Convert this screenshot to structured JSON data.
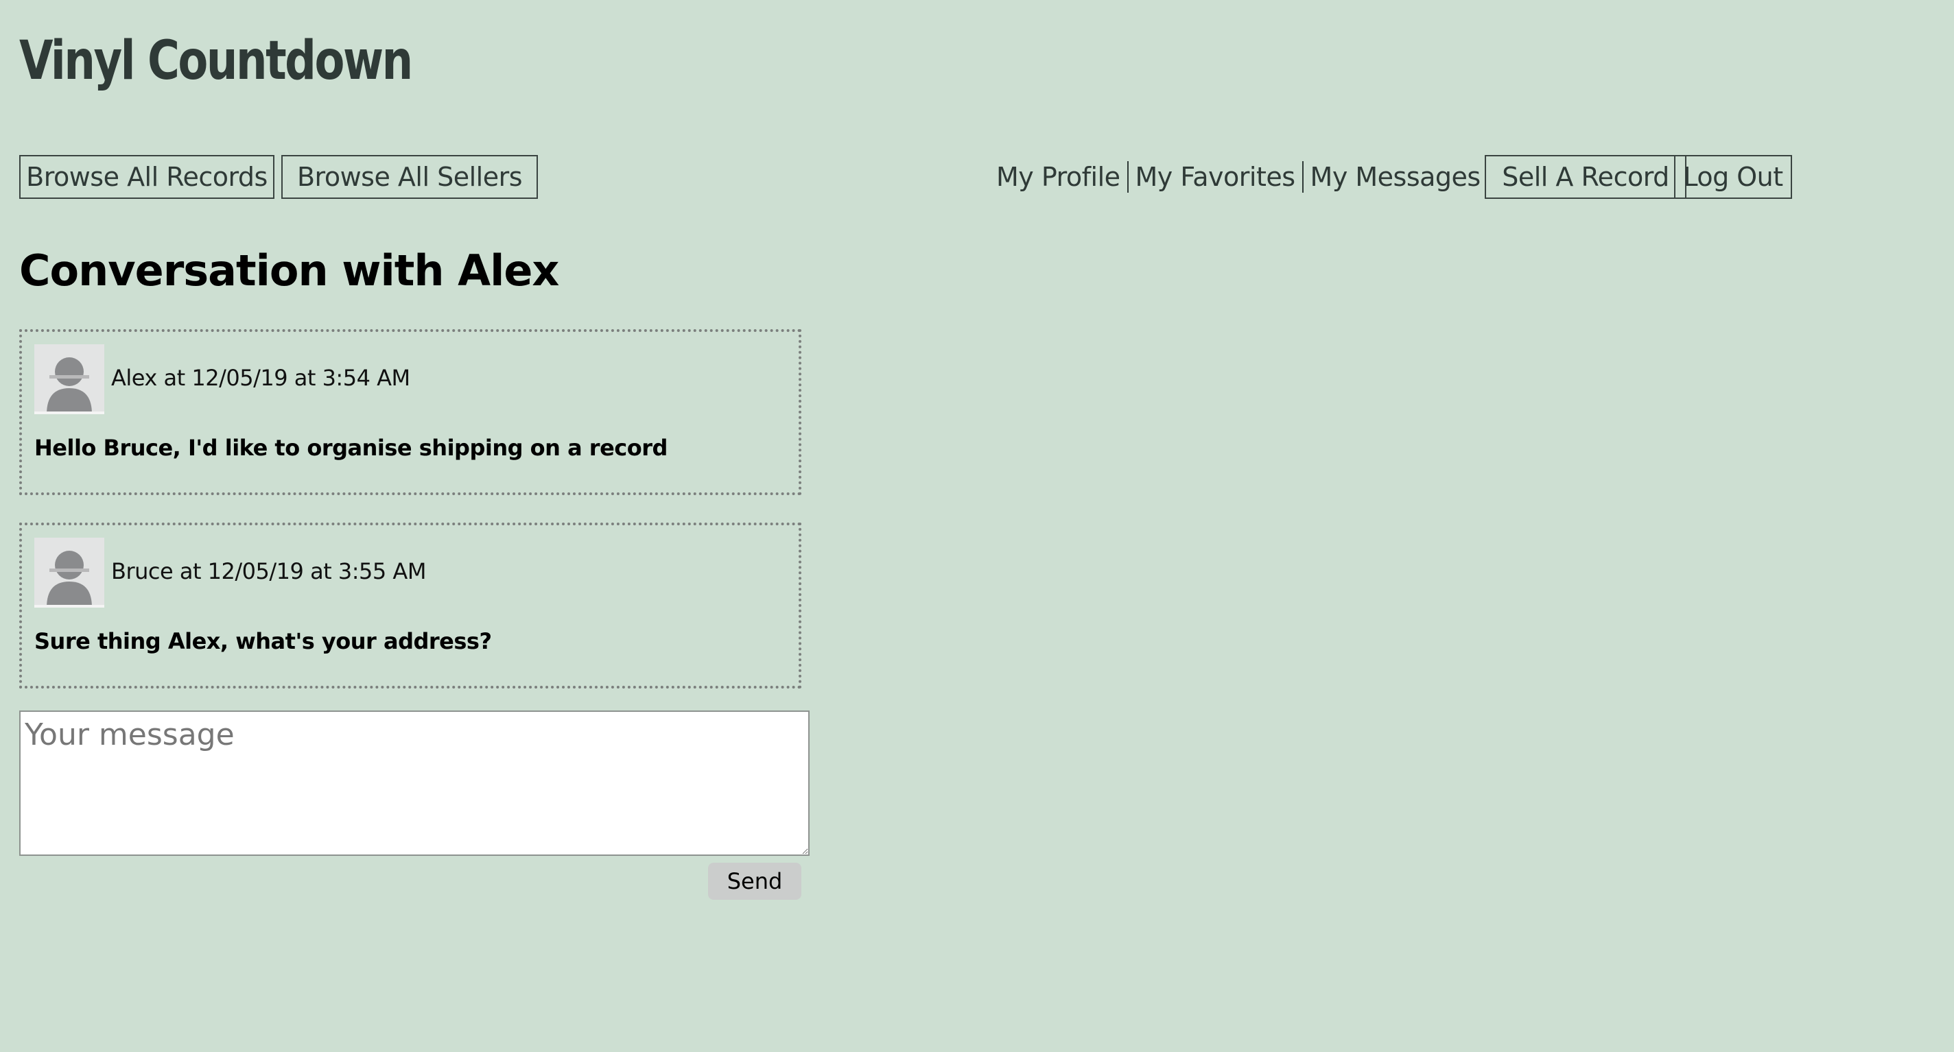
{
  "site": {
    "title": "Vinyl Countdown"
  },
  "nav": {
    "browse_records": "Browse All Records",
    "browse_sellers": "Browse All Sellers",
    "my_profile": "My Profile",
    "my_favorites": "My Favorites",
    "my_messages": "My Messages",
    "sell_record": "Sell A Record",
    "log_out": "Log Out"
  },
  "conversation": {
    "title": "Conversation with Alex",
    "messages": [
      {
        "meta": "Alex at 12/05/19 at 3:54 AM",
        "text": "Hello Bruce, I'd like to organise shipping on a record"
      },
      {
        "meta": "Bruce at 12/05/19 at 3:55 AM",
        "text": "Sure thing Alex, what's your address?"
      }
    ]
  },
  "composer": {
    "placeholder": "Your message",
    "send_label": "Send"
  },
  "colors": {
    "background": "#cddfd2",
    "text_dark": "#2f3a37",
    "avatar_bg": "#e3e4e4",
    "avatar_figure": "#8a8b8d",
    "send_bg": "#cbcdcc"
  }
}
